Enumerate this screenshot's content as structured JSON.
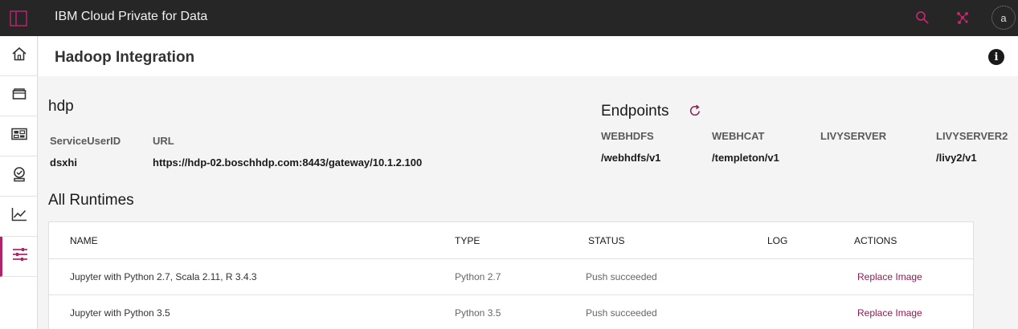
{
  "app": {
    "title": "IBM Cloud Private for Data"
  },
  "topbar": {
    "icons": [
      "panel-icon",
      "search-icon",
      "network-icon"
    ],
    "avatar": "a"
  },
  "sidebar": {
    "items": [
      "home-icon",
      "folder-icon",
      "dashboard-icon",
      "badge-icon",
      "line-chart-icon",
      "sliders-icon"
    ],
    "active": "sliders-icon"
  },
  "header": {
    "title": "Hadoop Integration"
  },
  "cluster": {
    "name": "hdp",
    "service_user_label": "ServiceUserID",
    "service_user_value": "dsxhi",
    "url_label": "URL",
    "url_value": "https://hdp-02.boschhdp.com:8443/gateway/10.1.2.100"
  },
  "endpoints": {
    "title": "Endpoints",
    "items": [
      {
        "label": "WEBHDFS",
        "value": "/webhdfs/v1"
      },
      {
        "label": "WEBHCAT",
        "value": "/templeton/v1"
      },
      {
        "label": "LIVYSERVER",
        "value": ""
      },
      {
        "label": "LIVYSERVER2",
        "value": "/livy2/v1"
      }
    ]
  },
  "runtimes": {
    "title": "All Runtimes",
    "columns": [
      "NAME",
      "TYPE",
      "STATUS",
      "LOG",
      "ACTIONS"
    ],
    "rows": [
      {
        "name": "Jupyter with Python 2.7, Scala 2.11, R 3.4.3",
        "type": "Python 2.7",
        "status": "Push succeeded",
        "log": "",
        "action": "Replace Image"
      },
      {
        "name": "Jupyter with Python 3.5",
        "type": "Python 3.5",
        "status": "Push succeeded",
        "log": "",
        "action": "Replace Image"
      }
    ]
  },
  "colors": {
    "accent": "#b0246c",
    "link": "#8e1d55",
    "topbar": "#262626"
  }
}
